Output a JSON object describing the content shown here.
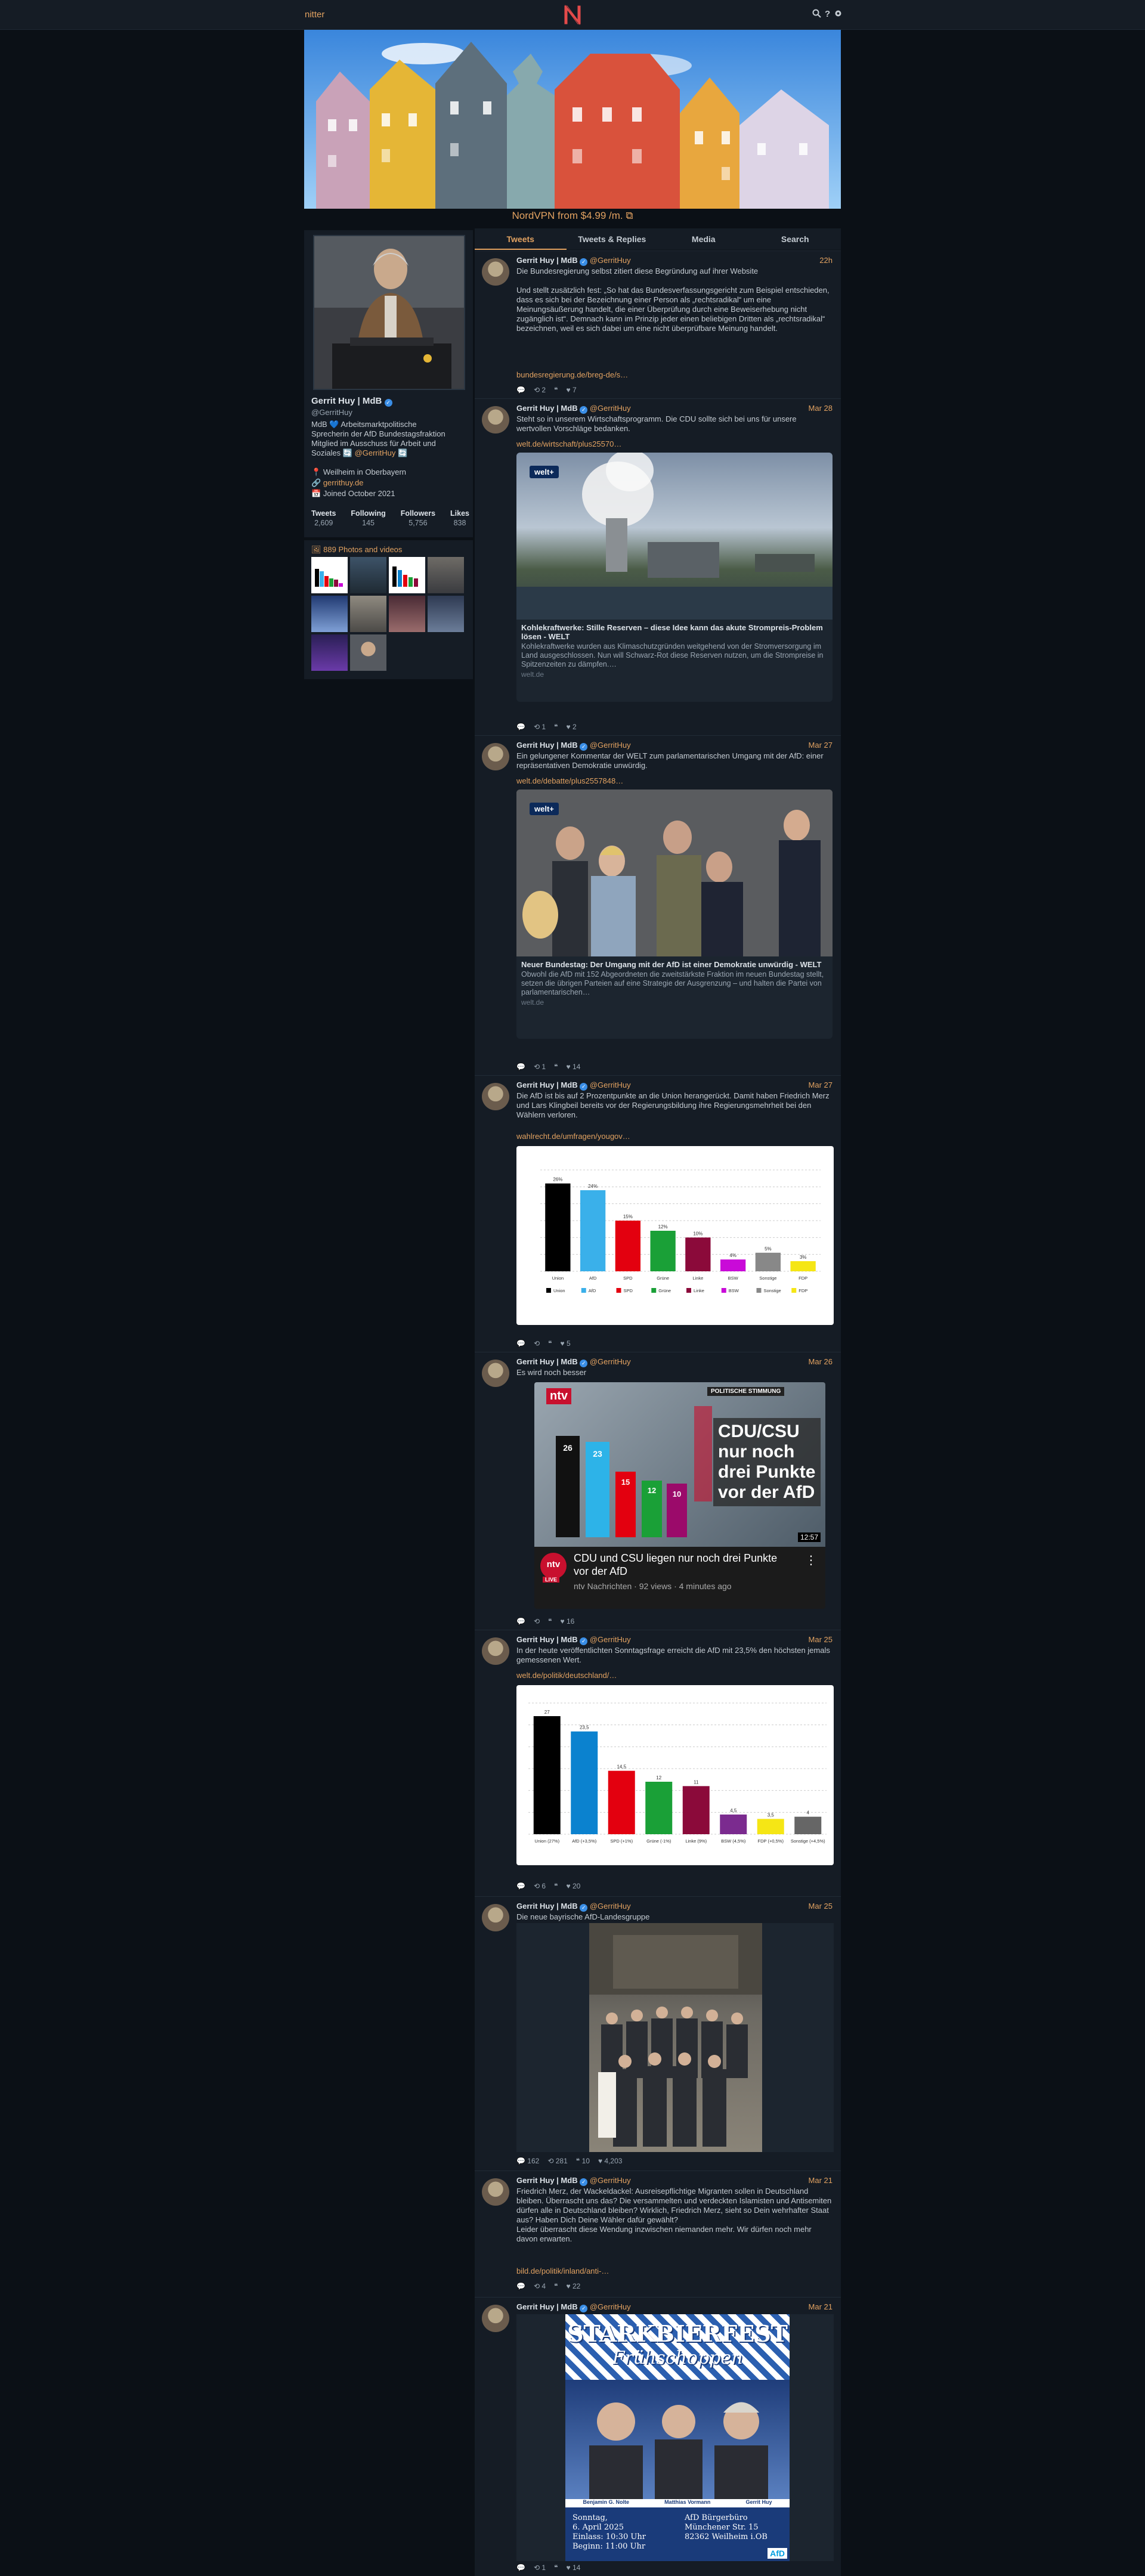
{
  "nav": {
    "brand": "nitter",
    "icons": [
      "search-icon",
      "help-icon",
      "settings-icon"
    ]
  },
  "sponsor": {
    "text": "NordVPN from $4.99 /m.",
    "icon": "external-link-icon"
  },
  "tabs": [
    "Tweets",
    "Tweets & Replies",
    "Media",
    "Search"
  ],
  "profile": {
    "fullname": "Gerrit Huy | MdB",
    "username": "@GerritHuy",
    "bio_1": "MdB 💙 Arbeitsmarktpolitische",
    "bio_2": "Sprecherin der AfD Bundestagsfraktion",
    "bio_3": "Mitglied im Ausschuss für Arbeit und",
    "bio_4": "Soziales 🔄",
    "bio_mention": "@GerritHuy",
    "bio_end": "🔄",
    "location": "Weilheim in Oberbayern",
    "website": "gerrithuy.de",
    "joined": "Joined October 2021",
    "stats": [
      {
        "label": "Tweets",
        "value": "2,609"
      },
      {
        "label": "Following",
        "value": "145"
      },
      {
        "label": "Followers",
        "value": "5,756"
      },
      {
        "label": "Likes",
        "value": "838"
      }
    ]
  },
  "photos": {
    "title": "889 Photos and videos"
  },
  "tweets": [
    {
      "name": "Gerrit Huy | MdB",
      "handle": "@GerritHuy",
      "date": "22h",
      "text": "Die Bundesregierung selbst zitiert diese Begründung auf ihrer Website\n\nUnd stellt zusätzlich fest: „So hat das Bundesverfassungsgericht zum Beispiel entschieden, dass es sich bei der Bezeichnung einer Person als „rechtsradikal“ um eine Meinungsäußerung handelt, die einer Überprüfung durch eine Beweiserhebung nicht zugänglich ist“. Demnach kann im Prinzip jeder einen beliebigen Dritten als „rechtsradikal“ bezeichnen, weil es sich dabei um eine nicht überprüfbare Meinung handelt.",
      "link": "bundesregierung.de/breg-de/s…",
      "stats": {
        "replies": "",
        "retweets": "2",
        "quotes": "",
        "likes": "7"
      }
    },
    {
      "name": "Gerrit Huy | MdB",
      "handle": "@GerritHuy",
      "date": "Mar 28",
      "text": "Steht so in unserem Wirtschaftsprogramm. Die CDU sollte sich bei uns für unsere wertvollen Vorschläge bedanken.",
      "link": "welt.de/wirtschaft/plus25570…",
      "card": {
        "badge": "welt+",
        "title": "Kohlekraftwerke: Stille Reserven – diese Idee kann das akute Strompreis-Problem lösen - WELT",
        "desc": "Kohlekraftwerke wurden aus Klimaschutzgründen weitgehend von der Stromversorgung im Land ausgeschlossen. Nun will Schwarz-Rot diese Reserven nutzen, um die Strompreise in Spitzenzeiten zu dämpfen.…",
        "domain": "welt.de"
      },
      "stats": {
        "replies": "",
        "retweets": "1",
        "quotes": "",
        "likes": "2"
      }
    },
    {
      "name": "Gerrit Huy | MdB",
      "handle": "@GerritHuy",
      "date": "Mar 27",
      "text": "Ein gelungener Kommentar der WELT zum parlamentarischen Umgang mit der AfD: einer repräsentativen Demokratie unwürdig.",
      "link": "welt.de/debatte/plus2557848…",
      "card": {
        "badge": "welt+",
        "title": "Neuer Bundestag: Der Umgang mit der AfD ist einer Demokratie unwürdig - WELT",
        "desc": "Obwohl die AfD mit 152 Abgeordneten die zweitstärkste Fraktion im neuen Bundestag stellt, setzen die übrigen Parteien auf eine Strategie der Ausgrenzung – und halten die Partei von parlamentarischen…",
        "domain": "welt.de"
      },
      "stats": {
        "replies": "",
        "retweets": "1",
        "quotes": "",
        "likes": "14"
      }
    },
    {
      "name": "Gerrit Huy | MdB",
      "handle": "@GerritHuy",
      "date": "Mar 27",
      "text": "Die AfD ist bis auf 2 Prozentpunkte an die Union herangerückt. Damit haben Friedrich Merz und Lars Klingbeil bereits vor der Regierungsbildung ihre Regierungsmehrheit bei den Wählern verloren.",
      "link": "wahlrecht.de/umfragen/yougov…",
      "stats": {
        "replies": "",
        "retweets": "",
        "quotes": "",
        "likes": "5"
      }
    },
    {
      "name": "Gerrit Huy | MdB",
      "handle": "@GerritHuy",
      "date": "Mar 26",
      "text": "Es wird noch besser",
      "video": {
        "tag": "ntv",
        "headline_1": "CDU/CSU",
        "headline_2": "nur noch",
        "headline_3": "drei Punkte",
        "headline_4": "vor der AfD",
        "corner": "POLITISCHE STIMMUNG",
        "duration": "12:57",
        "title": "CDU und CSU liegen nur noch drei Punkte vor der AfD",
        "channel": "ntv Nachrichten · 92 views · 4 minutes ago",
        "live": "LIVE",
        "bars": [
          "26",
          "23",
          "15",
          "12",
          "10"
        ]
      },
      "stats": {
        "replies": "",
        "retweets": "",
        "quotes": "",
        "likes": "16"
      }
    },
    {
      "name": "Gerrit Huy | MdB",
      "handle": "@GerritHuy",
      "date": "Mar 25",
      "text": "In der heute veröffentlichten Sonntagsfrage erreicht die AfD mit 23,5% den höchsten jemals gemessenen Wert.",
      "link": "welt.de/politik/deutschland/…",
      "stats": {
        "replies": "",
        "retweets": "6",
        "quotes": "",
        "likes": "20"
      }
    },
    {
      "name": "Gerrit Huy | MdB",
      "handle": "@GerritHuy",
      "date": "Mar 25",
      "text": "Die neue bayrische AfD-Landesgruppe",
      "stats": {
        "replies": "162",
        "retweets": "281",
        "quotes": "10",
        "likes": "4,203"
      }
    },
    {
      "name": "Gerrit Huy | MdB",
      "handle": "@GerritHuy",
      "date": "Mar 21",
      "text": "Friedrich Merz, der Wackeldackel: Ausreisepflichtige Migranten sollen in Deutschland bleiben. Überrascht uns das? Die versammelten und verdeckten Islamisten und Antisemiten dürfen alle in Deutschland bleiben? Wirklich, Friedrich Merz, sieht so Dein wehrhafter Staat aus? Haben Dich Deine Wähler dafür gewählt?\nLeider überrascht diese Wendung inzwischen niemanden mehr. Wir dürfen noch mehr davon erwarten.",
      "link": "bild.de/politik/inland/anti-…",
      "stats": {
        "replies": "",
        "retweets": "4",
        "quotes": "",
        "likes": "22"
      }
    },
    {
      "name": "Gerrit Huy | MdB",
      "handle": "@GerritHuy",
      "date": "Mar 21",
      "text": "",
      "poster": {
        "title_1": "STARKBIERFEST",
        "title_2": "Frühschoppen",
        "date": "Sonntag,\n6. April 2025\nEinlass: 10:30 Uhr\nBeginn: 11:00 Uhr",
        "venue": "AfD Bürgerbüro\nMünchener Str. 15\n82362 Weilheim i.OB",
        "names": [
          "Benjamin G. Nolte",
          "Matthias Vormann",
          "Gerrit Huy"
        ],
        "party": "AfD"
      },
      "stats": {
        "replies": "",
        "retweets": "1",
        "quotes": "",
        "likes": "14"
      }
    }
  ],
  "chart_data": [
    {
      "type": "bar",
      "title": "",
      "categories": [
        "Union",
        "AfD",
        "SPD",
        "Grüne",
        "Linke",
        "BSW",
        "Sonstige",
        "FDP"
      ],
      "values": [
        26,
        24,
        15,
        12,
        10,
        3.5,
        5.5,
        3
      ],
      "value_labels": [
        "26%",
        "24%",
        "15%",
        "12%",
        "10%",
        "4%",
        "5%",
        "3%"
      ],
      "colors": [
        "#000000",
        "#3ab0ea",
        "#e3000f",
        "#1aa037",
        "#8b0a3a",
        "#c90ad8",
        "#888888",
        "#f5e615"
      ],
      "legend": [
        "Union",
        "AfD",
        "SPD",
        "Grüne",
        "Linke",
        "BSW",
        "Sonstige",
        "FDP"
      ],
      "ylim": [
        0,
        30
      ],
      "grid": true
    },
    {
      "type": "bar",
      "title": "",
      "categories": [
        "Union (27%)",
        "AfD (+3,5%)",
        "SPD (+1%)",
        "Grüne (-1%)",
        "Linke (9%)",
        "BSW (4,5%)",
        "FDP (+0,5%)",
        "Sonstige (+4,5%)"
      ],
      "values": [
        27,
        23.5,
        14.5,
        12,
        11,
        4.5,
        3.5,
        4
      ],
      "value_labels": [
        "27",
        "23,5",
        "14,5",
        "12",
        "11",
        "4,5",
        "3,5",
        "4"
      ],
      "colors": [
        "#000000",
        "#0b82cf",
        "#e3000f",
        "#1aa037",
        "#8b0a3a",
        "#7b2b8f",
        "#f5e615",
        "#666666"
      ],
      "ylim": [
        0,
        30
      ],
      "grid": true
    }
  ]
}
